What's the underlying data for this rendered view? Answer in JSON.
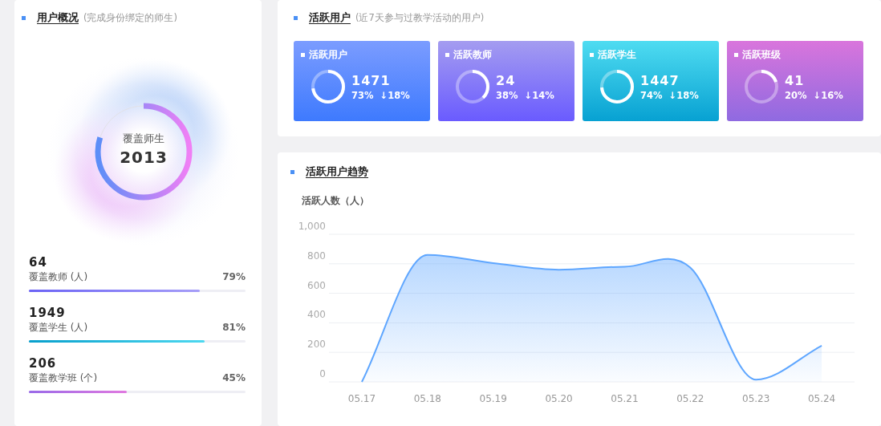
{
  "overview": {
    "title": "用户概况",
    "subtitle": "(完成身份绑定的师生)",
    "ring": {
      "label": "覆盖师生",
      "value": "2013",
      "level": 0.8
    },
    "stats": [
      {
        "value": "64",
        "label": "覆盖教师 (人)",
        "percent": "79%",
        "level": 0.79,
        "kind": "teacher"
      },
      {
        "value": "1949",
        "label": "覆盖学生 (人)",
        "percent": "81%",
        "level": 0.81,
        "kind": "student"
      },
      {
        "value": "206",
        "label": "覆盖教学班 (个)",
        "percent": "45%",
        "level": 0.45,
        "kind": "class"
      }
    ]
  },
  "active": {
    "title": "活跃用户",
    "subtitle": "(近7天参与过教学活动的用户)",
    "cards": [
      {
        "title": "活跃用户",
        "value": "1471",
        "percent": "73%",
        "change": "↓18%",
        "level": 0.73,
        "kind": "blue"
      },
      {
        "title": "活跃教师",
        "value": "24",
        "percent": "38%",
        "change": "↓14%",
        "level": 0.38,
        "kind": "purple"
      },
      {
        "title": "活跃学生",
        "value": "1447",
        "percent": "74%",
        "change": "↓18%",
        "level": 0.74,
        "kind": "cyan"
      },
      {
        "title": "活跃班级",
        "value": "41",
        "percent": "20%",
        "change": "↓16%",
        "level": 0.2,
        "kind": "magenta"
      }
    ]
  },
  "trend": {
    "title": "活跃用户趋势",
    "chart_data": {
      "type": "area",
      "ylabel": "活跃人数（人）",
      "categories": [
        "05.17",
        "05.18",
        "05.19",
        "05.20",
        "05.21",
        "05.22",
        "05.23",
        "05.24"
      ],
      "series": [
        {
          "color": "#5ea6ff",
          "values": [
            0,
            860,
            805,
            760,
            780,
            775,
            15,
            245
          ]
        }
      ],
      "grid": true,
      "ylim": [
        0,
        1000
      ],
      "yticks": [
        0,
        200,
        400,
        600,
        {
          "value": 800,
          "label": "800"
        },
        {
          "value": 1000,
          "label": "1,000"
        }
      ]
    }
  }
}
